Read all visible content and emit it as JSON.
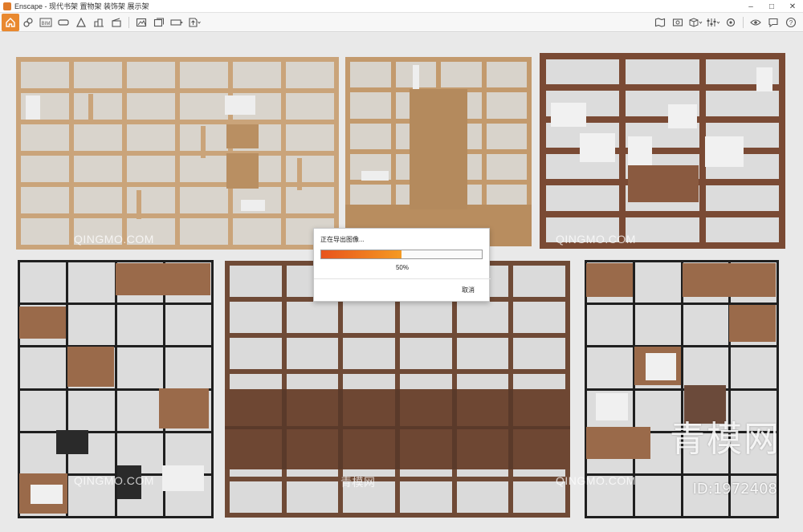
{
  "window": {
    "title": "Enscape - 现代书架 置物架 装饰架 展示架",
    "controls": {
      "minimize": "–",
      "maximize": "□",
      "close": "✕"
    }
  },
  "toolbar": {
    "icons": [
      "home-icon",
      "chain-link-icon",
      "bim-icon",
      "vr-headset-icon",
      "asset-library-icon",
      "city-buildings-icon",
      "clapperboard-icon",
      "image-export-icon",
      "batch-export-icon",
      "panorama-export-icon",
      "upload-icon",
      "visual-settings-icon",
      "map-icon",
      "screenshot-icon",
      "cube-views-icon",
      "settings-icon",
      "eye-icon",
      "feedback-icon",
      "help-icon"
    ],
    "bim_label": "BIM"
  },
  "dialog": {
    "title": "正在导出图像...",
    "progress_text": "50%",
    "progress_value": 0.5,
    "cancel_label": "取消",
    "colors": {
      "fill_start": "#e8531c",
      "fill_end": "#f49a23"
    }
  },
  "watermarks": {
    "latin": "QINGMO.COM",
    "cn": "青模网",
    "brand_cn": "青模网",
    "brand_id": "ID:1972408"
  },
  "accent": "#e9892f"
}
